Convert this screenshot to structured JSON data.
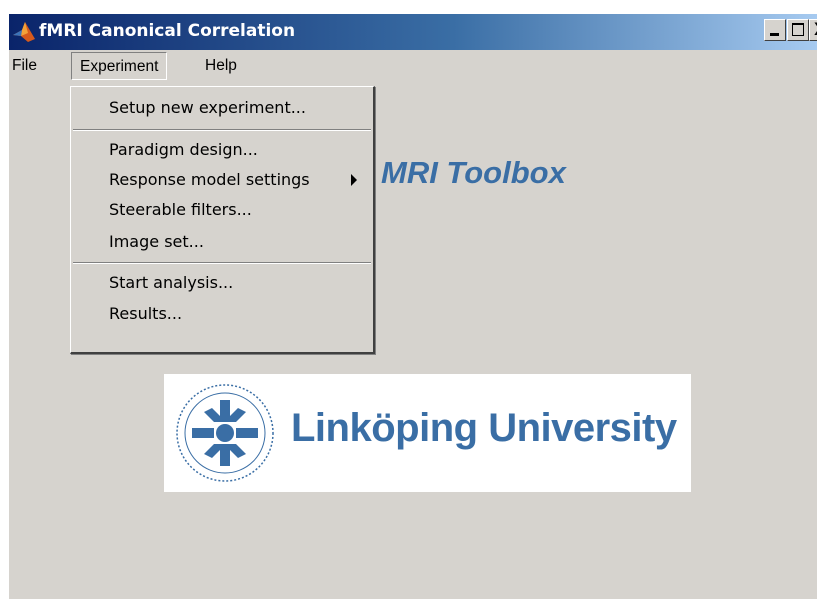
{
  "window": {
    "title": "fMRI Canonical Correlation",
    "controls": {
      "minimize": "minimize",
      "maximize": "maximize",
      "close": "X"
    }
  },
  "menubar": {
    "file": "File",
    "experiment": "Experiment",
    "help": "Help"
  },
  "experiment_menu": {
    "items": [
      "Setup new experiment...",
      "Paradigm design...",
      "Response model settings",
      "Steerable filters...",
      "Image set...",
      "Start analysis...",
      "Results..."
    ]
  },
  "content": {
    "title_visible": "MRI Toolbox",
    "logo_text": "Linköping University"
  },
  "icons": {
    "app": "matlab-icon",
    "submenu": "chevron-right-icon",
    "seal": "university-seal-icon"
  },
  "colors": {
    "titlebar_start": "#0a246a",
    "titlebar_end": "#a6caf0",
    "window_bg": "#d6d3ce",
    "accent_blue": "#3a6ea5"
  }
}
